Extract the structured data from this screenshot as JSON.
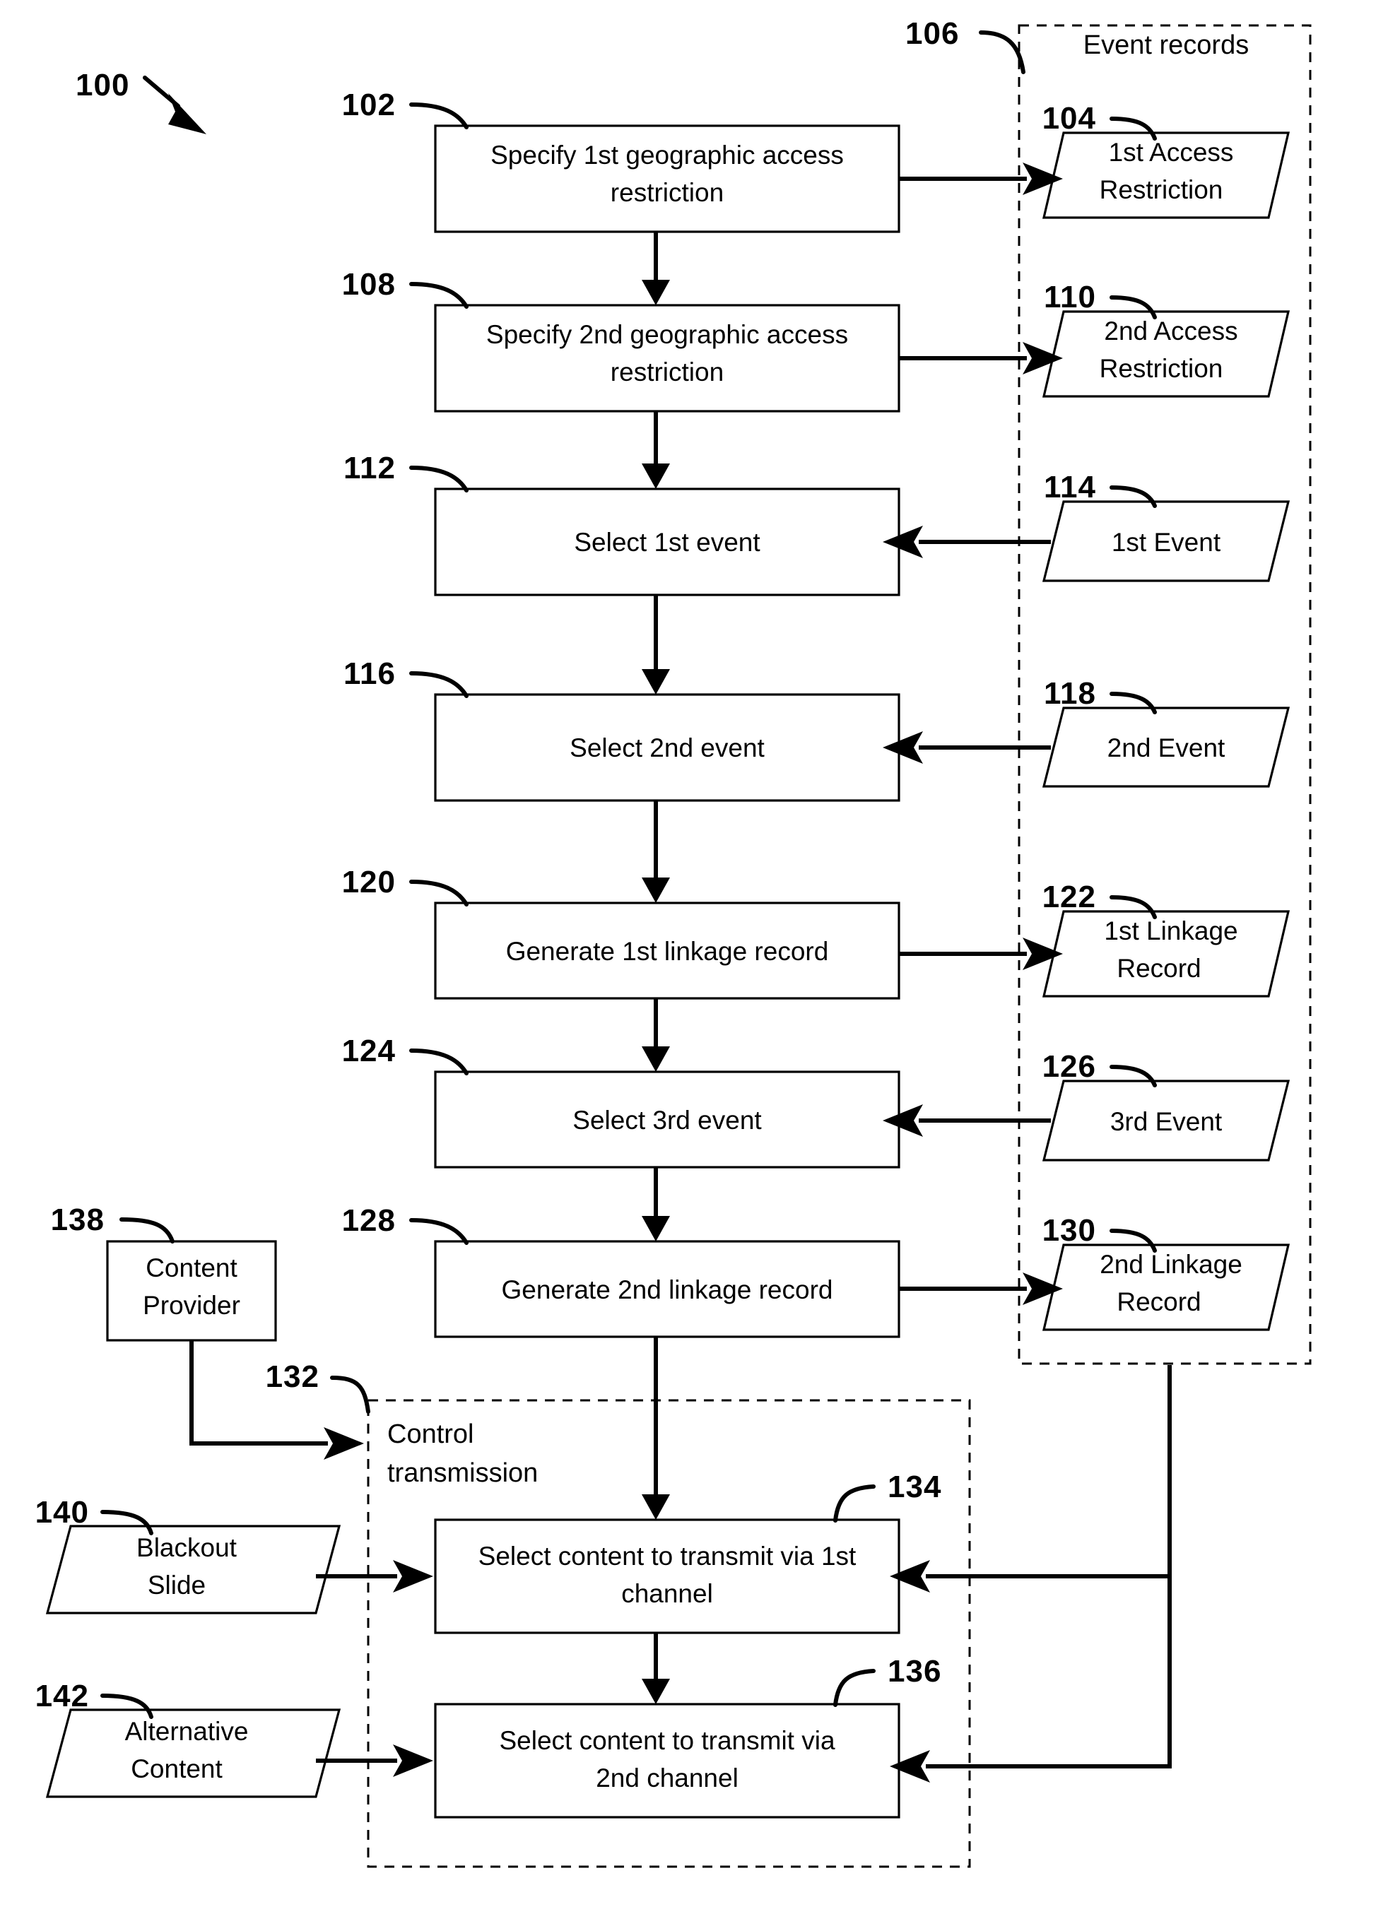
{
  "figure": {
    "figure_ref": "100",
    "groups": [
      {
        "ref": "106",
        "title": "Event records"
      },
      {
        "ref": "132",
        "title_line1": "Control",
        "title_line2": "transmission"
      }
    ],
    "process_steps": [
      {
        "ref": "102",
        "line1": "Specify 1st geographic access",
        "line2": "restriction"
      },
      {
        "ref": "108",
        "line1": "Specify 2nd geographic access",
        "line2": "restriction"
      },
      {
        "ref": "112",
        "line1": "Select 1st event",
        "line2": ""
      },
      {
        "ref": "116",
        "line1": "Select 2nd event",
        "line2": ""
      },
      {
        "ref": "120",
        "line1": "Generate 1st linkage record",
        "line2": ""
      },
      {
        "ref": "124",
        "line1": "Select 3rd event",
        "line2": ""
      },
      {
        "ref": "128",
        "line1": "Generate 2nd linkage record",
        "line2": ""
      },
      {
        "ref": "134",
        "line1": "Select content to transmit via 1st",
        "line2": "channel"
      },
      {
        "ref": "136",
        "line1": "Select content to transmit via",
        "line2": "2nd channel"
      }
    ],
    "data_objects": [
      {
        "ref": "104",
        "line1": "1st Access",
        "line2": "Restriction"
      },
      {
        "ref": "110",
        "line1": "2nd Access",
        "line2": "Restriction"
      },
      {
        "ref": "114",
        "line1": "1st Event",
        "line2": ""
      },
      {
        "ref": "118",
        "line1": "2nd Event",
        "line2": ""
      },
      {
        "ref": "122",
        "line1": "1st Linkage",
        "line2": "Record"
      },
      {
        "ref": "126",
        "line1": "3rd Event",
        "line2": ""
      },
      {
        "ref": "130",
        "line1": "2nd Linkage",
        "line2": "Record"
      },
      {
        "ref": "140",
        "line1": "Blackout",
        "line2": "Slide"
      },
      {
        "ref": "142",
        "line1": "Alternative",
        "line2": "Content"
      }
    ],
    "entity_boxes": [
      {
        "ref": "138",
        "line1": "Content",
        "line2": "Provider"
      }
    ],
    "colors": {
      "ink": "#000000",
      "paper": "#ffffff"
    }
  }
}
